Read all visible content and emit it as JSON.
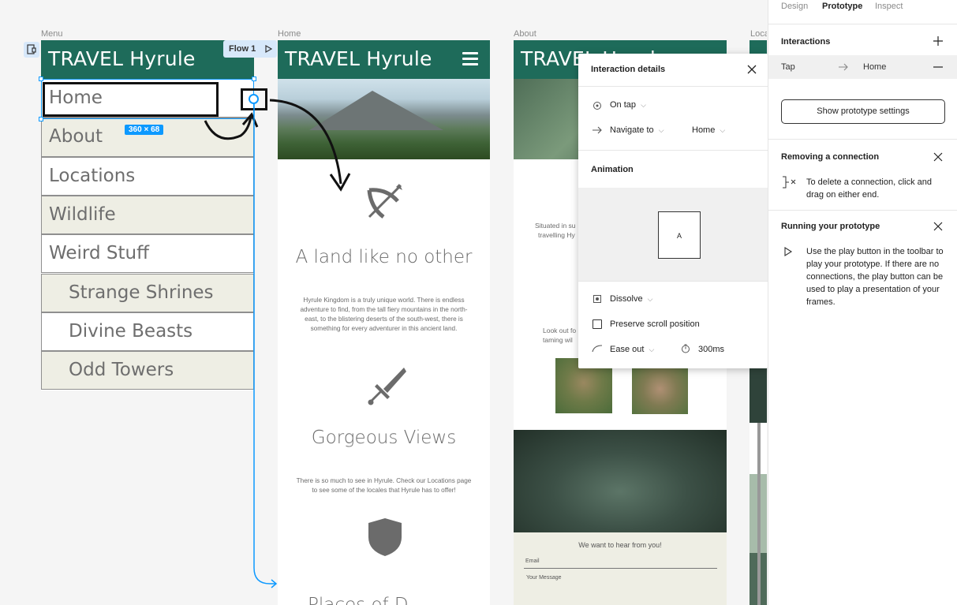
{
  "frame_labels": {
    "menu": "Menu",
    "home": "Home",
    "about": "About",
    "locations": "Loca"
  },
  "menu": {
    "brand": "TRAVEL Hyrule",
    "items": [
      {
        "label": "Home"
      },
      {
        "label": "About"
      },
      {
        "label": "Locations"
      },
      {
        "label": "Wildlife"
      },
      {
        "label": "Weird Stuff"
      },
      {
        "label": "Strange Shrines"
      },
      {
        "label": "Divine Beasts"
      },
      {
        "label": "Odd Towers"
      }
    ],
    "size_badge": "360 × 68",
    "flow_label": "Flow 1"
  },
  "home": {
    "brand": "TRAVEL Hyrule",
    "sections": [
      {
        "title": "A land like no other",
        "text": "Hyrule Kingdom is a truly unique world. There is endless adventure to find, from the tall fiery mountains in the north-east, to the blistering deserts of the south-west, there is something for every adventurer in this ancient land."
      },
      {
        "title": "Gorgeous Views",
        "text": "There is so much to see in Hyrule. Check our Locations page to see some of the locales that Hyrule has to offer!"
      },
      {
        "title": "Places of D"
      }
    ]
  },
  "about": {
    "brand": "TRAVEL Hyrule",
    "partial_text_1": "Situated in su",
    "partial_text_2": "travelling Hy",
    "partial_text_3": "Look out fo",
    "partial_text_4": "taming wil",
    "contact_heading": "We want to hear from you!",
    "email_placeholder": "Email",
    "message_placeholder": "Your Message"
  },
  "popup": {
    "title": "Interaction details",
    "trigger": "On tap",
    "action": "Navigate to",
    "destination": "Home",
    "animation_heading": "Animation",
    "preview_letter": "A",
    "animation_type": "Dissolve",
    "preserve_scroll": "Preserve scroll position",
    "easing": "Ease out",
    "duration": "300ms"
  },
  "right_panel": {
    "tabs": [
      "Design",
      "Prototype",
      "Inspect"
    ],
    "interactions_heading": "Interactions",
    "interaction": {
      "trigger": "Tap",
      "target": "Home"
    },
    "show_settings_button": "Show prototype settings",
    "removing_heading": "Removing a connection",
    "removing_text": "To delete a connection, click and drag on either end.",
    "running_heading": "Running your prototype",
    "running_text": "Use the play button in the toolbar to play your prototype. If there are no connections, the play button can be used to play a presentation of your frames."
  },
  "colors": {
    "header_green": "#1e6b5a",
    "selection_blue": "#0d99ff",
    "alt_row": "#eeeee4"
  }
}
